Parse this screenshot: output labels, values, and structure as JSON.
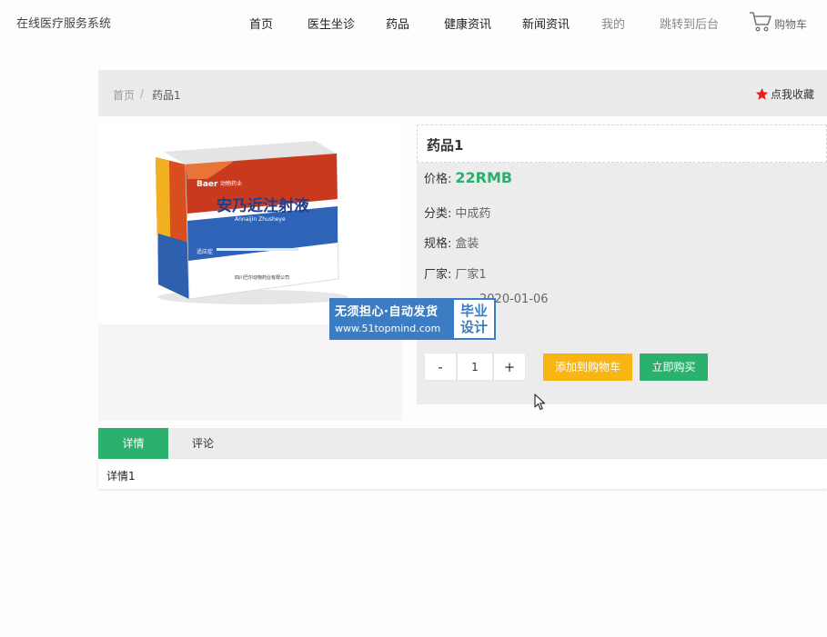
{
  "site": {
    "title": "在线医疗服务系统"
  },
  "nav": {
    "items": [
      "首页",
      "医生坐诊",
      "药品",
      "健康资讯",
      "新闻资讯",
      "我的",
      "跳转到后台"
    ],
    "cart_label": "购物车"
  },
  "breadcrumb": {
    "home": "首页",
    "separator": "/",
    "current": "药品1"
  },
  "favorite": {
    "label": "点我收藏",
    "icon": "star-icon",
    "color": "#e02020"
  },
  "product": {
    "name": "药品1",
    "price_label": "价格:",
    "price": "22RMB",
    "category_label": "分类:",
    "category": "中成药",
    "spec_label": "规格:",
    "spec": "盒装",
    "maker_label": "厂家:",
    "maker": "厂家1",
    "date_value": "2020-01-06",
    "quantity": "1",
    "minus": "-",
    "plus": "+",
    "add_to_cart": "添加到购物车",
    "buy_now": "立即购买"
  },
  "package": {
    "brand": "Baer",
    "brand_cn": "动物药业",
    "name": "安乃近注射液",
    "pinyin": "Annaijin Zhusheye",
    "usage_label": "适应症",
    "maker": "四川巴尔动物药业有限公司"
  },
  "watermark": {
    "line1": "无须担心·自动发货",
    "line2": "www.51topmind.com",
    "badge": "毕业设计"
  },
  "tabs": {
    "details": "详情",
    "comments": "评论"
  },
  "details": {
    "content": "详情1"
  },
  "colors": {
    "accent_green": "#2bb06d",
    "cart_orange": "#f9b512",
    "watermark_blue": "#3b7cc2"
  }
}
